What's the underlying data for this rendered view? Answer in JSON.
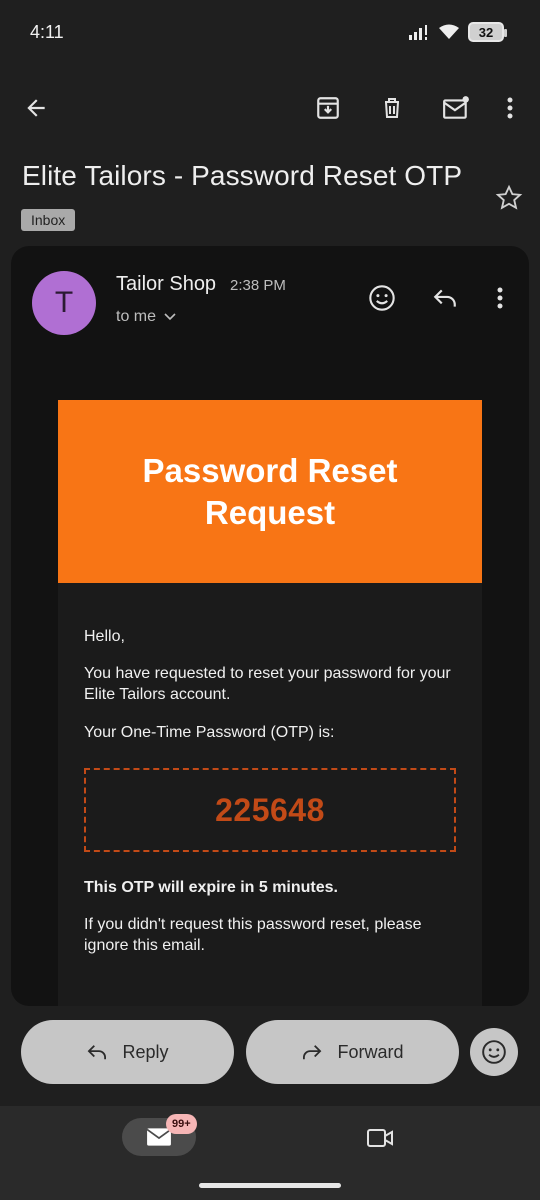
{
  "status_bar": {
    "time": "4:11",
    "battery": "32"
  },
  "email": {
    "subject": "Elite Tailors - Password Reset OTP",
    "label": "Inbox",
    "sender_initial": "T",
    "sender_name": "Tailor Shop",
    "time": "2:38 PM",
    "recipient": "to me"
  },
  "body": {
    "banner_title": "Password Reset Request",
    "greeting": "Hello,",
    "request_text": "You have requested to reset your password for your Elite Tailors account.",
    "otp_intro": "Your One-Time Password (OTP) is:",
    "otp_code": "225648",
    "expiry_text": "This OTP will expire in 5 minutes.",
    "ignore_text": "If you didn't request this password reset, please ignore this email."
  },
  "actions": {
    "reply_label": "Reply",
    "forward_label": "Forward"
  },
  "bottom_nav": {
    "mail_badge": "99+"
  },
  "icons": [
    "back-icon",
    "archive-icon",
    "delete-icon",
    "mark-unread-icon",
    "more-vert-icon",
    "star-icon",
    "emoji-icon",
    "reply-icon",
    "forward-icon",
    "mail-icon",
    "video-icon"
  ],
  "colors": {
    "banner": "#f87515",
    "otp": "#c24a17",
    "avatar": "#b06fd3"
  }
}
